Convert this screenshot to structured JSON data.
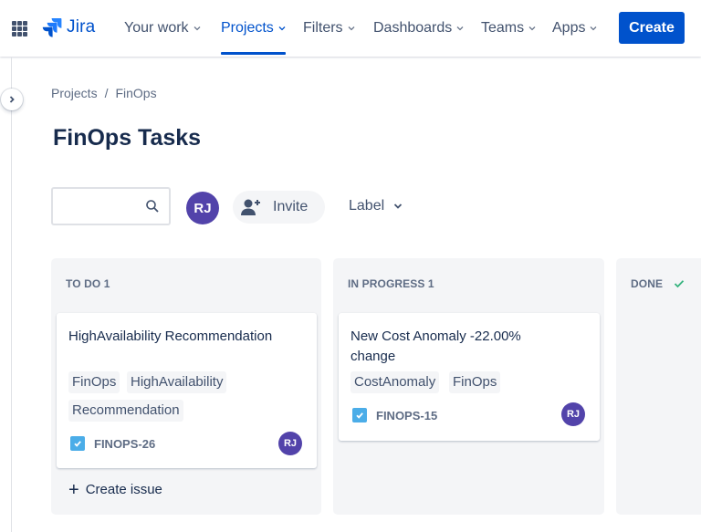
{
  "app": {
    "logo_text": "Jira"
  },
  "nav": {
    "items": [
      {
        "label": "Your work"
      },
      {
        "label": "Projects"
      },
      {
        "label": "Filters"
      },
      {
        "label": "Dashboards"
      },
      {
        "label": "Teams"
      },
      {
        "label": "Apps"
      }
    ],
    "active": "Projects",
    "create_label": "Create"
  },
  "breadcrumb": {
    "items": [
      "Projects",
      "FinOps"
    ],
    "separator": "/"
  },
  "page": {
    "title": "FinOps Tasks"
  },
  "toolbar": {
    "search": {
      "value": "",
      "placeholder": ""
    },
    "avatar_initials": "RJ",
    "invite_label": "Invite",
    "label_filter": "Label"
  },
  "board": {
    "columns": [
      {
        "title": "TO DO 1",
        "cards": [
          {
            "title": "HighAvailability Recommendation",
            "tags": [
              "FinOps",
              "HighAvailability",
              "Recommendation"
            ],
            "key": "FINOPS-26",
            "assignee": "RJ"
          }
        ],
        "create_label": "Create issue"
      },
      {
        "title": "IN PROGRESS 1",
        "cards": [
          {
            "title": "New Cost Anomaly -22.00% change",
            "tags": [
              "CostAnomaly",
              "FinOps"
            ],
            "key": "FINOPS-15",
            "assignee": "RJ"
          }
        ]
      },
      {
        "title": "DONE",
        "cards": []
      }
    ]
  },
  "colors": {
    "brand": "#0052cc",
    "avatar": "#5243aa",
    "checkbox": "#4bade8",
    "done_check": "#36b37e",
    "column_bg": "#f4f5f7"
  },
  "icons": {
    "app_switcher": "app-switcher-icon",
    "search": "search-icon",
    "invite": "add-person-icon",
    "done": "checkmark-icon",
    "task": "task-checkbox-icon"
  }
}
